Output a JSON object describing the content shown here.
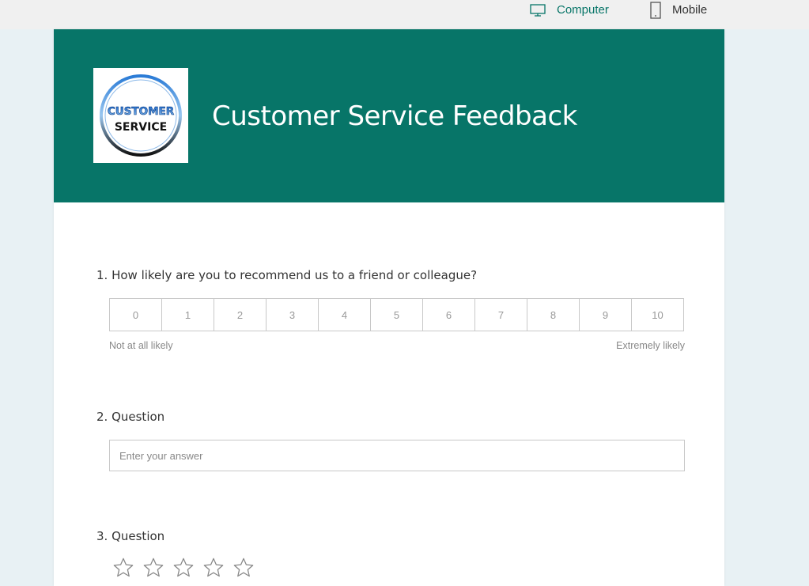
{
  "view_toggle": {
    "computer_label": "Computer",
    "mobile_label": "Mobile",
    "active": "computer",
    "active_color": "#077568"
  },
  "form": {
    "title": "Customer Service Feedback",
    "header_color": "#077568",
    "logo": {
      "line1": "CUSTOMER",
      "line2": "SERVICE"
    }
  },
  "questions": {
    "q1": {
      "title": "1. How likely are you to recommend us to a friend or colleague?",
      "scale": [
        "0",
        "1",
        "2",
        "3",
        "4",
        "5",
        "6",
        "7",
        "8",
        "9",
        "10"
      ],
      "low_label": "Not at all likely",
      "high_label": "Extremely likely"
    },
    "q2": {
      "title": "2. Question",
      "placeholder": "Enter your answer",
      "value": ""
    },
    "q3": {
      "title": "3. Question",
      "star_count": 5,
      "rating": 0
    }
  }
}
